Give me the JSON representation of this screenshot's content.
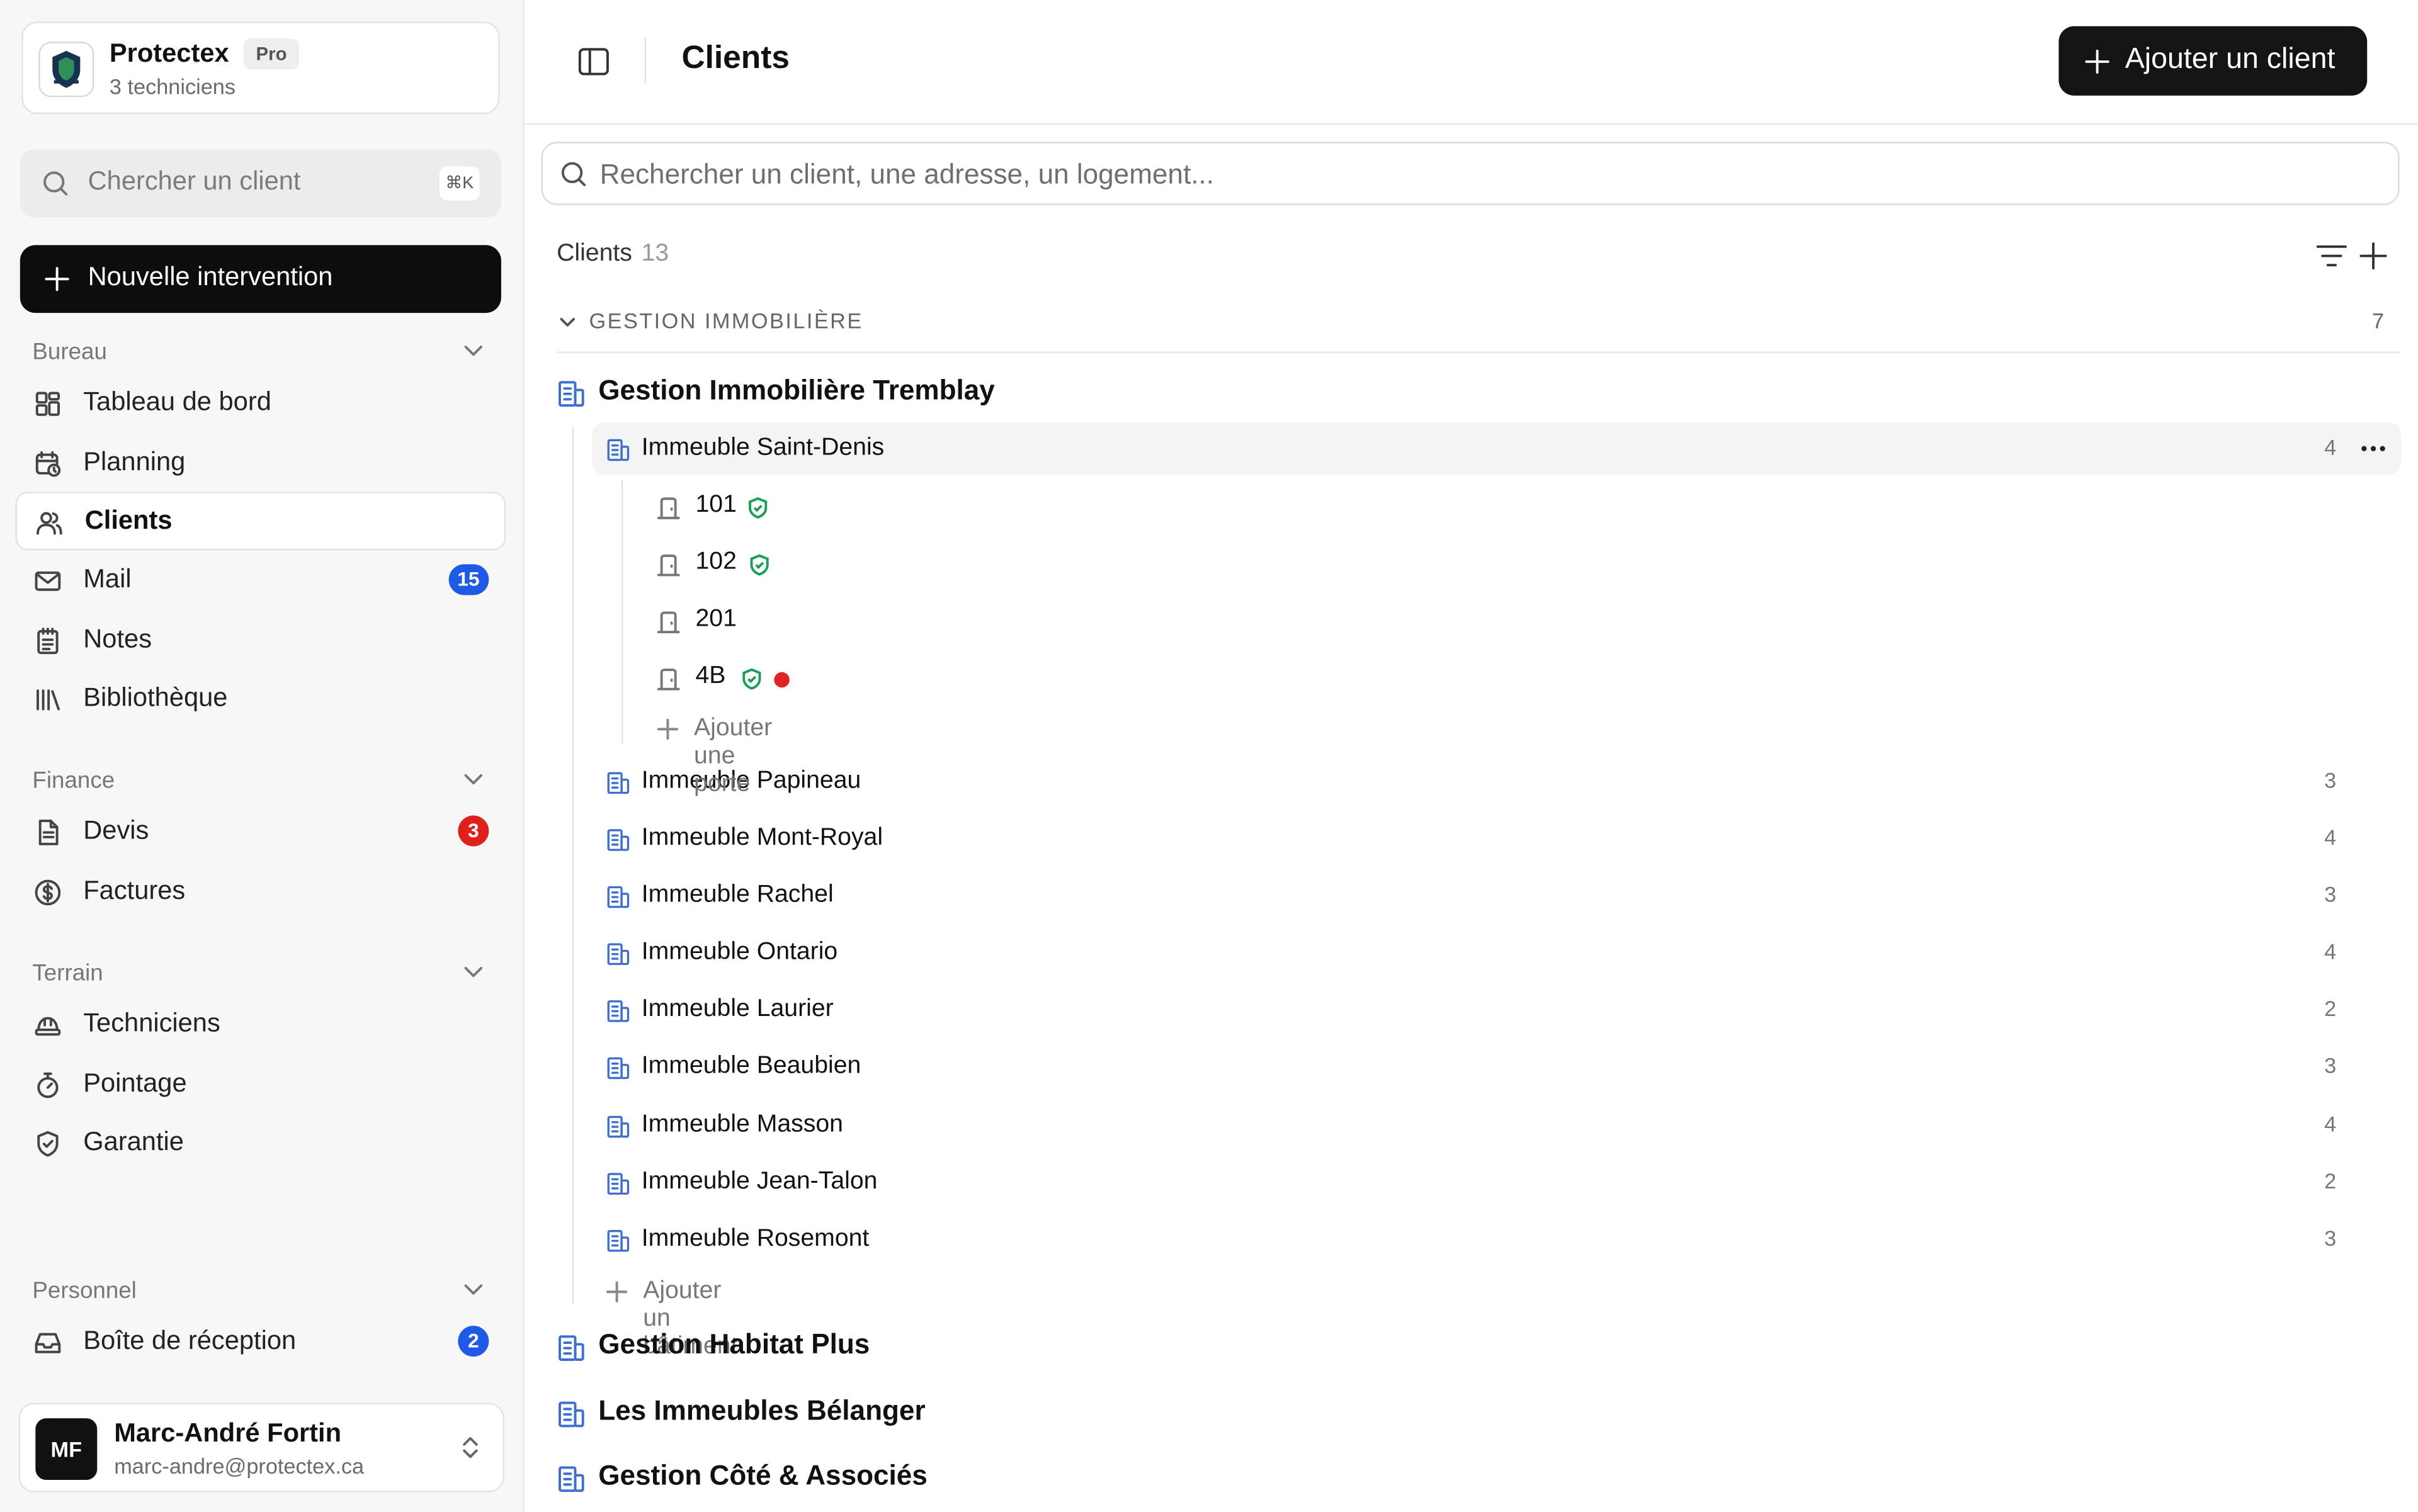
{
  "org": {
    "name": "Protectex",
    "plan": "Pro",
    "subtitle": "3 techniciens"
  },
  "sidebar_search": {
    "placeholder": "Chercher un client",
    "shortcut": "⌘K"
  },
  "new_intervention": "Nouvelle intervention",
  "sections": {
    "bureau": "Bureau",
    "finance": "Finance",
    "terrain": "Terrain",
    "personnel": "Personnel"
  },
  "nav": {
    "dashboard": "Tableau de bord",
    "planning": "Planning",
    "clients": "Clients",
    "mail": "Mail",
    "mail_badge": "15",
    "notes": "Notes",
    "library": "Bibliothèque",
    "quotes": "Devis",
    "quotes_badge": "3",
    "invoices": "Factures",
    "technicians": "Techniciens",
    "timesheet": "Pointage",
    "warranty": "Garantie",
    "inbox": "Boîte de réception",
    "inbox_badge": "2"
  },
  "user": {
    "initials": "MF",
    "name": "Marc-André Fortin",
    "email": "marc-andre@protectex.ca"
  },
  "header": {
    "title": "Clients",
    "add_button": "Ajouter un client"
  },
  "main_search": {
    "placeholder": "Rechercher un client, une adresse, un logement..."
  },
  "list": {
    "label": "Clients",
    "count": "13"
  },
  "group": {
    "label": "GESTION IMMOBILIÈRE",
    "count": "7"
  },
  "clients": {
    "tremblay": "Gestion Immobilière Tremblay",
    "habitat": "Gestion Habitat Plus",
    "belanger": "Les Immeubles Bélanger",
    "cote": "Gestion Côté & Associés"
  },
  "buildings": [
    {
      "name": "Immeuble Saint-Denis",
      "count": "4"
    },
    {
      "name": "Immeuble Papineau",
      "count": "3"
    },
    {
      "name": "Immeuble Mont-Royal",
      "count": "4"
    },
    {
      "name": "Immeuble Rachel",
      "count": "3"
    },
    {
      "name": "Immeuble Ontario",
      "count": "4"
    },
    {
      "name": "Immeuble Laurier",
      "count": "2"
    },
    {
      "name": "Immeuble Beaubien",
      "count": "3"
    },
    {
      "name": "Immeuble Masson",
      "count": "4"
    },
    {
      "name": "Immeuble Jean-Talon",
      "count": "2"
    },
    {
      "name": "Immeuble Rosemont",
      "count": "3"
    }
  ],
  "units": [
    {
      "label": "101",
      "warranty": true,
      "alert": false
    },
    {
      "label": "102",
      "warranty": true,
      "alert": false
    },
    {
      "label": "201",
      "warranty": false,
      "alert": false
    },
    {
      "label": "4B",
      "warranty": true,
      "alert": true
    }
  ],
  "add_door": "Ajouter une porte",
  "add_building": "Ajouter un bâtiment",
  "colors": {
    "accent": "#111111",
    "badge_blue": "#1f5ae6",
    "badge_red": "#e0201c",
    "building_icon": "#3e6ecf",
    "warranty_green": "#1a9e55",
    "alert_red": "#e02424"
  }
}
